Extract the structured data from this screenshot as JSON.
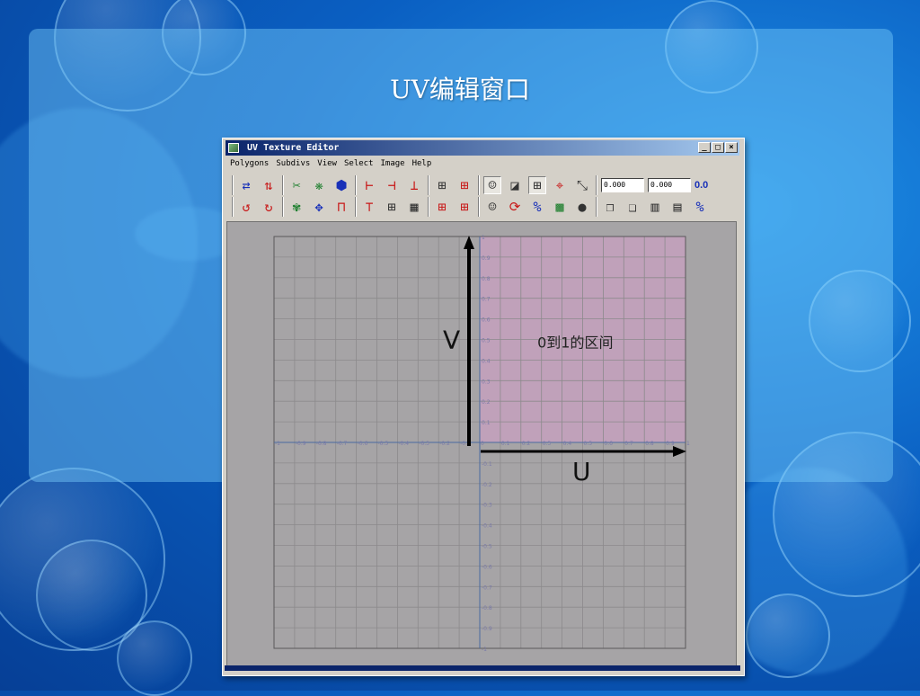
{
  "slide": {
    "title": "UV编辑窗口"
  },
  "window": {
    "title": "UV Texture Editor",
    "buttons": {
      "minimize": "_",
      "maximize": "□",
      "close": "×"
    },
    "menu": [
      "Polygons",
      "Subdivs",
      "View",
      "Select",
      "Image",
      "Help"
    ],
    "fields": {
      "u_value": "0.000",
      "v_value": "0.000",
      "reset_label": "0.0"
    }
  },
  "editor": {
    "u_axis_label": "U",
    "v_axis_label": "V",
    "range_label": "0到1的区间",
    "u_ticks": [
      "-1",
      "-0.9",
      "-0.8",
      "-0.7",
      "-0.6",
      "-0.5",
      "-0.4",
      "-0.3",
      "-0.2",
      "-0.1",
      "0",
      "0.1",
      "0.2",
      "0.3",
      "0.4",
      "0.5",
      "0.6",
      "0.7",
      "0.8",
      "0.9",
      "1"
    ],
    "v_ticks": [
      "1",
      "0.9",
      "0.8",
      "0.7",
      "0.6",
      "0.5",
      "0.4",
      "0.3",
      "0.2",
      "0.1",
      "-0.1",
      "-0.2",
      "-0.3",
      "-0.4",
      "-0.5",
      "-0.6",
      "-0.7",
      "-0.8",
      "-0.9",
      "-1"
    ],
    "u_range": [
      -1,
      1
    ],
    "v_range": [
      -1,
      1
    ],
    "highlight_range": {
      "u": [
        0,
        1
      ],
      "v": [
        0,
        1
      ],
      "color": "#c8a0c0"
    },
    "grid_color": "#8c8a8c"
  },
  "icons": {
    "row1": [
      "move-uv-icon",
      "flip-uv-icon",
      "cut-uv-icon",
      "sew-uv-icon",
      "merge-uv-icon",
      "align-left-icon",
      "align-right-icon",
      "align-bottom-icon",
      "grid-icon",
      "grid-add-icon",
      "display-image-icon",
      "shade-icon",
      "toggle-grid-icon",
      "pin-icon",
      "snap-icon"
    ],
    "row2": [
      "rotate-ccw-icon",
      "rotate-cw-icon",
      "unfold-icon",
      "relax-icon",
      "layout-icon",
      "align-top-icon",
      "grid-small-icon",
      "checker-icon",
      "grid-red-icon",
      "grid-red2-icon",
      "person-icon",
      "refresh-icon",
      "percent-icon",
      "color-image-icon",
      "circle-icon",
      "copy-icon",
      "paste-icon",
      "paste-u-icon",
      "paste-v-icon",
      "swap-icon"
    ]
  }
}
